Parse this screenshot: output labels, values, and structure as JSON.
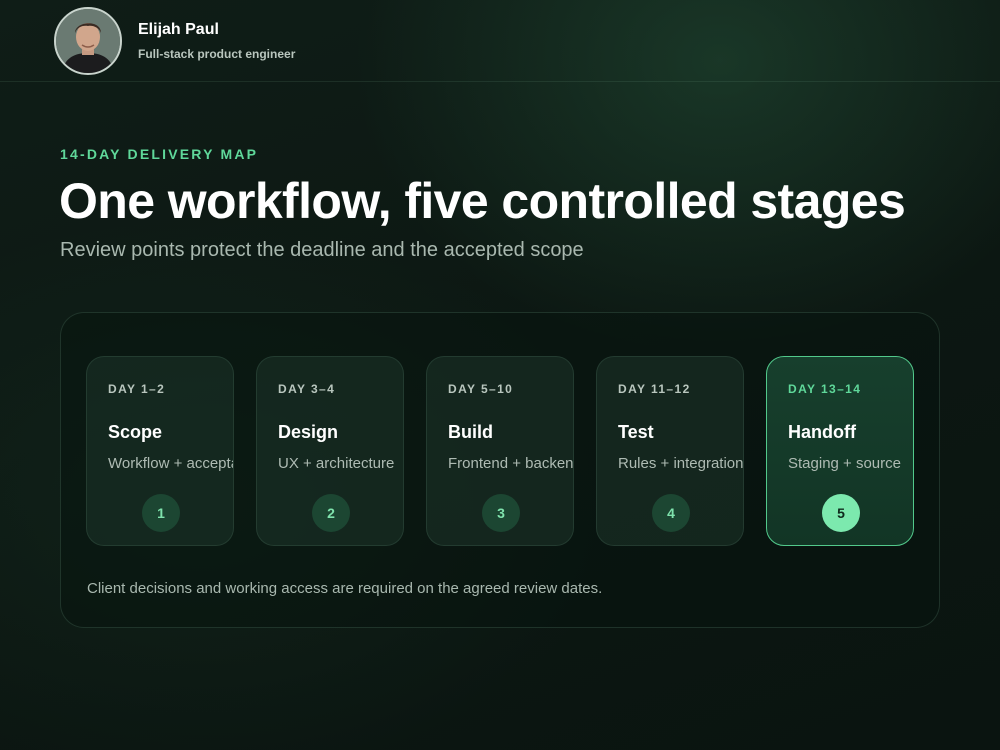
{
  "profile": {
    "name": "Elijah Paul",
    "role": "Full-stack product engineer"
  },
  "hero": {
    "eyebrow": "14-DAY DELIVERY MAP",
    "title": "One workflow, five controlled stages",
    "subtitle": "Review points protect the deadline and the accepted scope"
  },
  "stages": [
    {
      "day": "DAY 1–2",
      "name": "Scope",
      "desc": "Workflow + acceptance",
      "number": "1",
      "active": false
    },
    {
      "day": "DAY 3–4",
      "name": "Design",
      "desc": "UX + architecture",
      "number": "2",
      "active": false
    },
    {
      "day": "DAY 5–10",
      "name": "Build",
      "desc": "Frontend + backend",
      "number": "3",
      "active": false
    },
    {
      "day": "DAY 11–12",
      "name": "Test",
      "desc": "Rules + integrations",
      "number": "4",
      "active": false
    },
    {
      "day": "DAY 13–14",
      "name": "Handoff",
      "desc": "Staging + source",
      "number": "5",
      "active": true
    }
  ],
  "note": "Client decisions and working access are required on the agreed review dates.",
  "colors": {
    "accent": "#5fd89a",
    "active_badge": "#7ce9ae",
    "background": "#0c1712"
  }
}
